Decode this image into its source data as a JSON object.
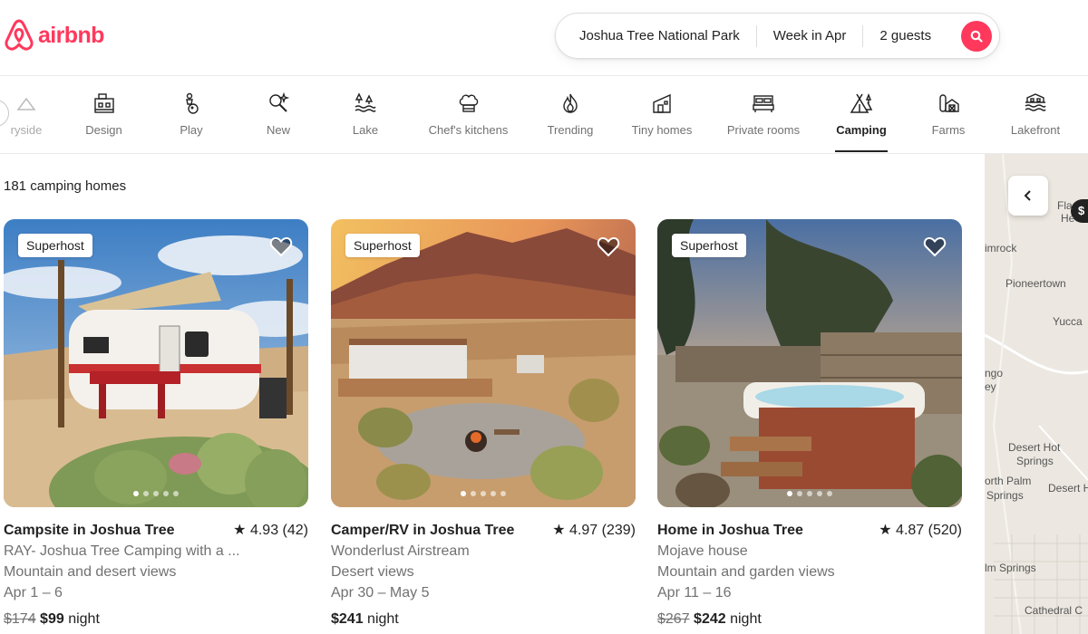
{
  "brand": {
    "name": "airbnb",
    "color": "#ff385c"
  },
  "search": {
    "location": "Joshua Tree National Park",
    "dates": "Week in Apr",
    "guests": "2 guests"
  },
  "categories": [
    {
      "label": "ryside",
      "icon": "countryside-icon"
    },
    {
      "label": "Design",
      "icon": "design-icon"
    },
    {
      "label": "Play",
      "icon": "play-icon"
    },
    {
      "label": "New",
      "icon": "new-icon"
    },
    {
      "label": "Lake",
      "icon": "lake-icon"
    },
    {
      "label": "Chef's kitchens",
      "icon": "chef-hat-icon"
    },
    {
      "label": "Trending",
      "icon": "flame-icon"
    },
    {
      "label": "Tiny homes",
      "icon": "tiny-home-icon"
    },
    {
      "label": "Private rooms",
      "icon": "bed-icon"
    },
    {
      "label": "Camping",
      "icon": "tent-icon",
      "active": true
    },
    {
      "label": "Farms",
      "icon": "barn-icon"
    },
    {
      "label": "Lakefront",
      "icon": "lakefront-icon"
    }
  ],
  "results": {
    "count_label": "181 camping homes"
  },
  "listings": [
    {
      "badge": "Superhost",
      "title": "Campsite in Joshua Tree",
      "rating": "★ 4.93 (42)",
      "name": "RAY- Joshua Tree Camping with a ...",
      "highlight": "Mountain and desert views",
      "dates": "Apr 1 – 6",
      "old_price": "$174",
      "price": "$99",
      "unit": "night"
    },
    {
      "badge": "Superhost",
      "title": "Camper/RV in Joshua Tree",
      "rating": "★ 4.97 (239)",
      "name": "Wonderlust Airstream",
      "highlight": "Desert views",
      "dates": "Apr 30 – May 5",
      "price": "$241",
      "unit": "night"
    },
    {
      "badge": "Superhost",
      "title": "Home in Joshua Tree",
      "rating": "★ 4.87 (520)",
      "name": "Mojave house",
      "highlight": "Mountain and garden views",
      "dates": "Apr 11 – 16",
      "old_price": "$267",
      "price": "$242",
      "unit": "night"
    }
  ],
  "map": {
    "pin": "$",
    "labels": [
      "Fla",
      "He",
      "imrock",
      "Pioneertown",
      "Yucca",
      "ngo",
      "ey",
      "Desert Hot",
      "Springs",
      "orth Palm",
      "Springs",
      "Desert H",
      "lm Springs",
      "Cathedral C"
    ]
  }
}
